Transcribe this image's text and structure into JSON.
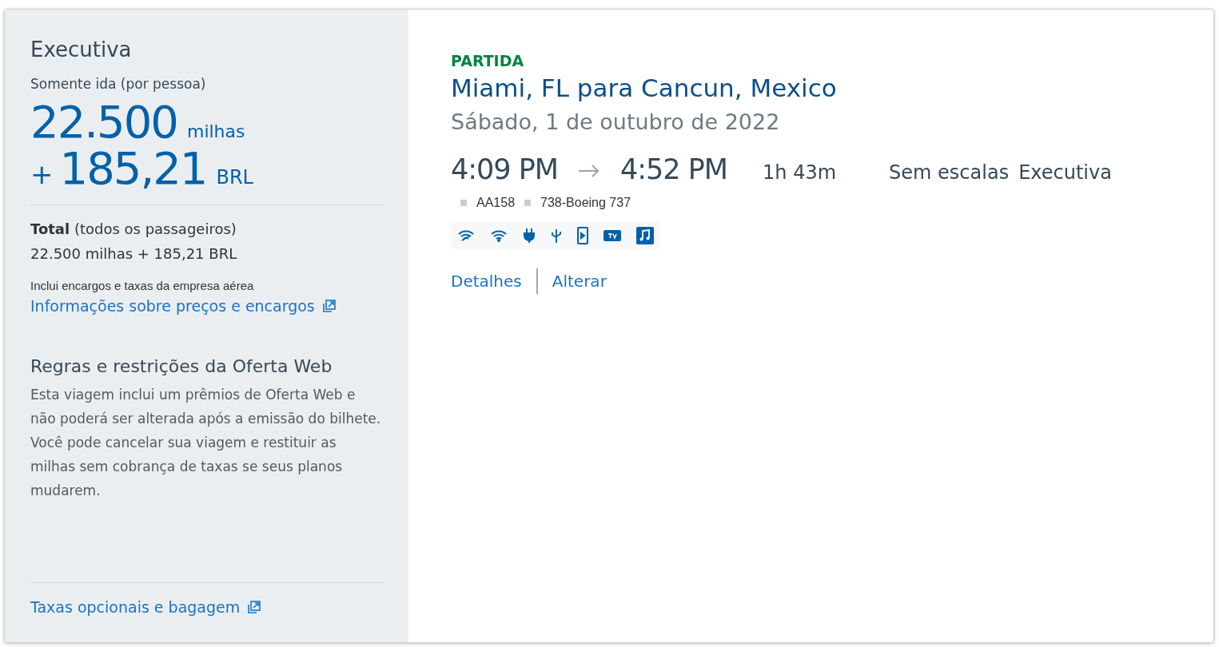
{
  "fare": {
    "cabin": "Executiva",
    "trip_type": "Somente ida (por pessoa)",
    "miles": "22.500",
    "miles_unit": "milhas",
    "plus": "+",
    "cash": "185,21",
    "currency": "BRL",
    "total_label": "**Total** (todos os passageiros)",
    "total_value": "22.500 milhas + 185,21 BRL",
    "includes_note": "Inclui encargos e taxas da empresa aérea",
    "pricing_link": "Informações sobre preços e encargos",
    "rules_title": "Regras e restrições da Oferta Web",
    "rules_text": "Esta viagem inclui um prêmios de Oferta Web e não poderá ser alterada após a emissão do bilhete. Você pode cancelar sua viagem e restituir as milhas sem cobrança de taxas se seus planos mudarem.",
    "fees_link": "Taxas opcionais e bagagem"
  },
  "flight": {
    "direction": "PARTIDA",
    "route": "Miami, FL para Cancun, Mexico",
    "date": "Sábado, 1 de outubro de 2022",
    "depart": "4:09 PM",
    "arrive": "4:52 PM",
    "duration": "1h 43m",
    "stops": "Sem escalas",
    "cabin": "Executiva",
    "flight_number": "AA158",
    "aircraft": "738-Boeing 737",
    "links": [
      "Detalhes",
      "Alterar"
    ]
  }
}
